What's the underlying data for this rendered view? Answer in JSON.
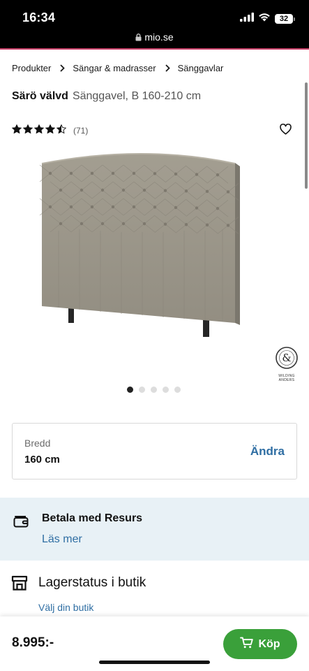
{
  "status_bar": {
    "time": "16:34",
    "battery": "32",
    "url": "mio.se"
  },
  "breadcrumb": [
    {
      "label": "Produkter"
    },
    {
      "label": "Sängar & madrasser"
    },
    {
      "label": "Sänggavlar"
    }
  ],
  "product": {
    "name": "Särö välvd",
    "description": "Sänggavel, B 160-210 cm",
    "rating_stars": 4.5,
    "review_count": "(71)",
    "image_alt": "Särö välvd sänggavel",
    "brand_badge": "WILDING ANDERS",
    "carousel": {
      "count": 5,
      "active": 0
    }
  },
  "width_selector": {
    "label": "Bredd",
    "value": "160 cm",
    "change_label": "Ändra"
  },
  "payment": {
    "title": "Betala med Resurs",
    "link": "Läs mer"
  },
  "stock": {
    "title": "Lagerstatus i butik",
    "link": "Välj din butik"
  },
  "footer": {
    "price": "8.995:-",
    "buy_label": "Köp"
  },
  "colors": {
    "accent_blue": "#2f6ea3",
    "buy_green": "#3aa03a",
    "banner_bg": "#e8f1f6"
  }
}
